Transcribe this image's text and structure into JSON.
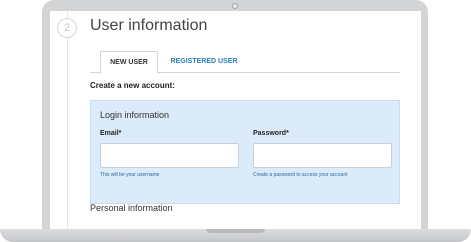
{
  "step": {
    "number": "2"
  },
  "page": {
    "title": "User information"
  },
  "tabs": [
    {
      "label": "NEW USER",
      "active": true
    },
    {
      "label": "REGISTERED USER",
      "active": false
    }
  ],
  "form": {
    "heading": "Create a new account:",
    "login": {
      "title": "Login information",
      "email": {
        "label": "Email*",
        "value": "",
        "help": "This will be your username"
      },
      "password": {
        "label": "Password*",
        "value": "",
        "help": "Create a password to access your account"
      }
    },
    "personal": {
      "title": "Personal information"
    }
  },
  "colors": {
    "panel_background": "#dcebf9",
    "link_blue": "#2a7fb6",
    "device_frame": "#d2d4d6"
  },
  "icons": {
    "camera": "camera-icon"
  }
}
